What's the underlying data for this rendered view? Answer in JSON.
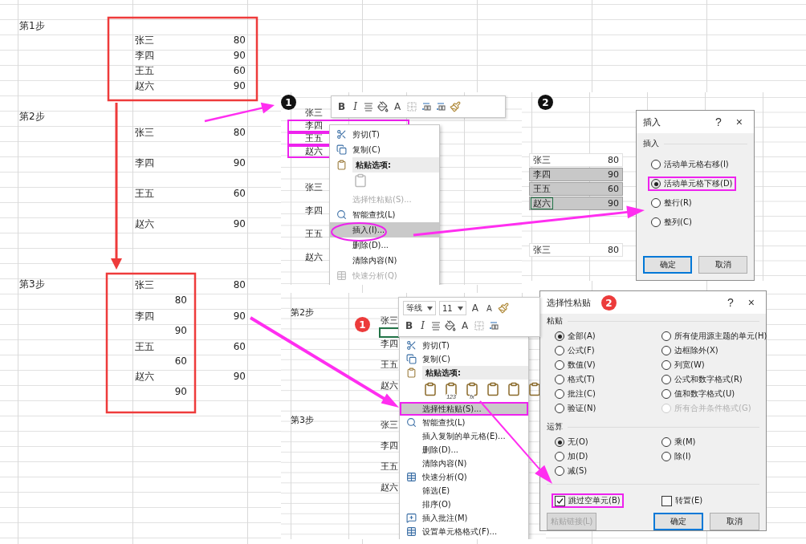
{
  "sheet": {
    "steps": [
      {
        "label": "第1步"
      },
      {
        "label": "第2步"
      },
      {
        "label": "第3步"
      }
    ],
    "block_1": [
      {
        "name": "张三",
        "score": "80"
      },
      {
        "name": "李四",
        "score": "90"
      },
      {
        "name": "王五",
        "score": "60"
      },
      {
        "name": "赵六",
        "score": "90"
      }
    ],
    "block_2": [
      {
        "name": "张三",
        "score": "80"
      },
      {
        "name": "李四",
        "score": "90"
      },
      {
        "name": "王五",
        "score": "60"
      },
      {
        "name": "赵六",
        "score": "90"
      }
    ],
    "block_3": [
      {
        "name": "张三",
        "score": "80",
        "pasted": "80"
      },
      {
        "name": "李四",
        "score": "90",
        "pasted": "90"
      },
      {
        "name": "王五",
        "score": "60",
        "pasted": "60"
      },
      {
        "name": "赵六",
        "score": "90",
        "pasted": "90"
      }
    ]
  },
  "panel_1": {
    "badge": "1",
    "toolbar": [
      {
        "kind": "bold",
        "label": "B"
      },
      {
        "kind": "italic",
        "label": "I"
      },
      {
        "kind": "align"
      },
      {
        "kind": "fill"
      },
      {
        "kind": "font-color",
        "label": "A"
      },
      {
        "kind": "border"
      },
      {
        "kind": "decimal"
      },
      {
        "kind": "decimal"
      },
      {
        "kind": "brush"
      }
    ],
    "rows": [
      {
        "name": "张三",
        "framed": false
      },
      {
        "name": "李四",
        "framed": true
      },
      {
        "name": "王五",
        "framed": true
      },
      {
        "name": "赵六",
        "framed": true
      },
      {
        "name": "张三",
        "framed": false
      },
      {
        "name": "李四",
        "framed": false
      },
      {
        "name": "王五",
        "framed": false
      },
      {
        "name": "赵六",
        "framed": false
      }
    ],
    "menu": [
      {
        "kind": "cut",
        "label": "剪切(T)",
        "disabled": false,
        "highlighted": false
      },
      {
        "kind": "copy",
        "label": "复制(C)",
        "disabled": false,
        "highlighted": false
      },
      {
        "kind": "header",
        "label": "粘贴选项:",
        "disabled": false,
        "highlighted": false
      },
      {
        "kind": "paste-icons",
        "icons": [
          {
            "kind": "clipboard"
          }
        ],
        "disabled": true,
        "highlighted": false
      },
      {
        "kind": "plain",
        "label": "选择性粘贴(S)...",
        "disabled": true,
        "highlighted": false
      },
      {
        "kind": "lookup",
        "label": "智能查找(L)",
        "disabled": false,
        "highlighted": false
      },
      {
        "kind": "plain",
        "label": "插入(I)...",
        "disabled": false,
        "highlighted": true
      },
      {
        "kind": "plain",
        "label": "删除(D)...",
        "disabled": false,
        "highlighted": false
      },
      {
        "kind": "plain",
        "label": "清除内容(N)",
        "disabled": false,
        "highlighted": false
      },
      {
        "kind": "analysis",
        "label": "快速分析(Q)",
        "disabled": true,
        "highlighted": false
      }
    ]
  },
  "panel_2": {
    "badge": "2",
    "rows": [
      {
        "name": "张三",
        "score": "80",
        "selected": false,
        "active": false
      },
      {
        "name": "李四",
        "score": "90",
        "selected": true,
        "active": false
      },
      {
        "name": "王五",
        "score": "60",
        "selected": true,
        "active": false
      },
      {
        "name": "赵六",
        "score": "90",
        "selected": true,
        "active": true
      },
      {
        "name": "张三",
        "score": "80",
        "selected": false,
        "active": false
      }
    ],
    "dialog": {
      "title": "插入",
      "help": "?",
      "close": "×",
      "group": "插入",
      "options": [
        {
          "label": "活动单元格右移(I)",
          "selected": false,
          "framed": false
        },
        {
          "label": "活动单元格下移(D)",
          "selected": true,
          "framed": true
        },
        {
          "label": "整行(R)",
          "selected": false,
          "framed": false
        },
        {
          "label": "整列(C)",
          "selected": false,
          "framed": false
        }
      ],
      "buttons": [
        {
          "label": "确定",
          "default": true
        },
        {
          "label": "取消",
          "default": false
        }
      ]
    }
  },
  "panel_3": {
    "badge": "1",
    "steps": [
      {
        "label": "第2步"
      },
      {
        "label": "第3步"
      }
    ],
    "names": [
      {
        "name": "张三"
      },
      {
        "name": "李四"
      },
      {
        "name": "王五"
      },
      {
        "name": "赵六"
      },
      {
        "name": "张三"
      },
      {
        "name": "李四"
      },
      {
        "name": "王五"
      },
      {
        "name": "赵六"
      }
    ],
    "toolbar_top": [
      {
        "kind": "field",
        "label": "等线"
      },
      {
        "kind": "field",
        "label": "11"
      },
      {
        "kind": "grow",
        "label": "A"
      },
      {
        "kind": "shrink",
        "label": "A"
      },
      {
        "kind": "brush"
      }
    ],
    "toolbar": [
      {
        "kind": "bold",
        "label": "B"
      },
      {
        "kind": "italic",
        "label": "I"
      },
      {
        "kind": "align"
      },
      {
        "kind": "fill"
      },
      {
        "kind": "font-color",
        "label": "A"
      },
      {
        "kind": "border"
      },
      {
        "kind": "decimal"
      }
    ],
    "menu": [
      {
        "kind": "cut",
        "label": "剪切(T)",
        "disabled": false,
        "highlighted": false,
        "framed": false
      },
      {
        "kind": "copy",
        "label": "复制(C)",
        "disabled": false,
        "highlighted": false,
        "framed": false
      },
      {
        "kind": "header",
        "label": "粘贴选项:",
        "disabled": false,
        "highlighted": false,
        "framed": false
      },
      {
        "kind": "paste-icons",
        "icons": [
          {
            "kind": "clipboard"
          },
          {
            "kind": "clipboard",
            "label": "123"
          },
          {
            "kind": "clipboard",
            "label": "fx"
          },
          {
            "kind": "clipboard"
          },
          {
            "kind": "clipboard"
          },
          {
            "kind": "clipboard"
          }
        ],
        "disabled": false,
        "highlighted": false,
        "framed": false
      },
      {
        "kind": "plain",
        "label": "选择性粘贴(S)...",
        "disabled": false,
        "highlighted": true,
        "framed": true
      },
      {
        "kind": "lookup",
        "label": "智能查找(L)",
        "disabled": false,
        "highlighted": false,
        "framed": false
      },
      {
        "kind": "plain",
        "label": "插入复制的单元格(E)...",
        "disabled": false,
        "highlighted": false,
        "framed": false
      },
      {
        "kind": "plain",
        "label": "删除(D)...",
        "disabled": false,
        "highlighted": false,
        "framed": false
      },
      {
        "kind": "plain",
        "label": "清除内容(N)",
        "disabled": false,
        "highlighted": false,
        "framed": false
      },
      {
        "kind": "analysis",
        "label": "快速分析(Q)",
        "disabled": false,
        "highlighted": false,
        "framed": false
      },
      {
        "kind": "plain",
        "label": "筛选(E)",
        "disabled": false,
        "highlighted": false,
        "framed": false
      },
      {
        "kind": "plain",
        "label": "排序(O)",
        "disabled": false,
        "highlighted": false,
        "framed": false
      },
      {
        "kind": "comment",
        "label": "插入批注(M)",
        "disabled": false,
        "highlighted": false,
        "framed": false
      },
      {
        "kind": "format",
        "label": "设置单元格格式(F)...",
        "disabled": false,
        "highlighted": false,
        "framed": false
      }
    ]
  },
  "paste_dialog": {
    "title": "选择性粘贴",
    "badge": "2",
    "help": "?",
    "close": "×",
    "paste_group": "粘贴",
    "paste_options": [
      {
        "label": "全部(A)",
        "selected": true,
        "disabled": false
      },
      {
        "label": "所有使用源主题的单元(H)",
        "selected": false,
        "disabled": false
      },
      {
        "label": "公式(F)",
        "selected": false,
        "disabled": false
      },
      {
        "label": "边框除外(X)",
        "selected": false,
        "disabled": false
      },
      {
        "label": "数值(V)",
        "selected": false,
        "disabled": false
      },
      {
        "label": "列宽(W)",
        "selected": false,
        "disabled": false
      },
      {
        "label": "格式(T)",
        "selected": false,
        "disabled": false
      },
      {
        "label": "公式和数字格式(R)",
        "selected": false,
        "disabled": false
      },
      {
        "label": "批注(C)",
        "selected": false,
        "disabled": false
      },
      {
        "label": "值和数字格式(U)",
        "selected": false,
        "disabled": false
      },
      {
        "label": "验证(N)",
        "selected": false,
        "disabled": false
      },
      {
        "label": "所有合并条件格式(G)",
        "selected": false,
        "disabled": true
      }
    ],
    "operation_group": "运算",
    "operations": [
      {
        "label": "无(O)",
        "selected": true
      },
      {
        "label": "乘(M)",
        "selected": false
      },
      {
        "label": "加(D)",
        "selected": false
      },
      {
        "label": "除(I)",
        "selected": false
      },
      {
        "label": "减(S)",
        "selected": false
      }
    ],
    "checks": [
      {
        "label": "跳过空单元(B)",
        "checked": true,
        "framed": true
      },
      {
        "label": "转置(E)",
        "checked": false,
        "framed": false
      }
    ],
    "buttons": [
      {
        "label": "粘贴链接(L)",
        "disabled": true,
        "default": false
      },
      {
        "label": "确定",
        "disabled": false,
        "default": true
      },
      {
        "label": "取消",
        "disabled": false,
        "default": false
      }
    ]
  }
}
